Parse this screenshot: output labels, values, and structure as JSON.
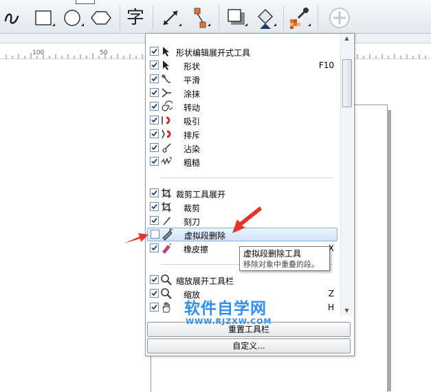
{
  "toolbar": {
    "text_tool_glyph": "字",
    "tools": [
      "freehand-tool",
      "rectangle-tool",
      "ellipse-tool",
      "polygon-tool",
      "text-tool",
      "dimension-tool",
      "connector-tool",
      "drop-shadow-tool",
      "fill-tool",
      "eyedropper-tool",
      "add-tool"
    ]
  },
  "ruler": {
    "labels": [
      "100",
      "50"
    ]
  },
  "menu": {
    "sections": [
      {
        "header": "形状编辑展开式工具",
        "items": [
          {
            "label": "形状",
            "shortcut": "F10"
          },
          {
            "label": "平滑",
            "shortcut": ""
          },
          {
            "label": "涂抹",
            "shortcut": ""
          },
          {
            "label": "转动",
            "shortcut": ""
          },
          {
            "label": "吸引",
            "shortcut": ""
          },
          {
            "label": "排斥",
            "shortcut": ""
          },
          {
            "label": "沾染",
            "shortcut": ""
          },
          {
            "label": "粗糙",
            "shortcut": ""
          }
        ]
      },
      {
        "header": "裁剪工具展开",
        "items": [
          {
            "label": "裁剪",
            "shortcut": ""
          },
          {
            "label": "刻刀",
            "shortcut": ""
          },
          {
            "label": "虚拟段删除",
            "shortcut": "",
            "checked": false
          },
          {
            "label": "橡皮擦",
            "shortcut": "X"
          }
        ]
      },
      {
        "header": "缩放展开工具栏",
        "items": [
          {
            "label": "缩放",
            "shortcut": "Z"
          },
          {
            "label": "",
            "shortcut": "H"
          }
        ]
      }
    ],
    "reset_button": "重置工具栏",
    "customize_button": "自定义..."
  },
  "tooltip": {
    "title": "虚拟段删除工具",
    "description": "移除对象中重叠的段。"
  },
  "watermark": {
    "cn": "软件自学网",
    "en": "WWW.RJZXW.COM"
  },
  "colors": {
    "highlight_border": "#7fb2e6",
    "arrow": "#e8322b",
    "watermark": "#2f8ff0"
  }
}
